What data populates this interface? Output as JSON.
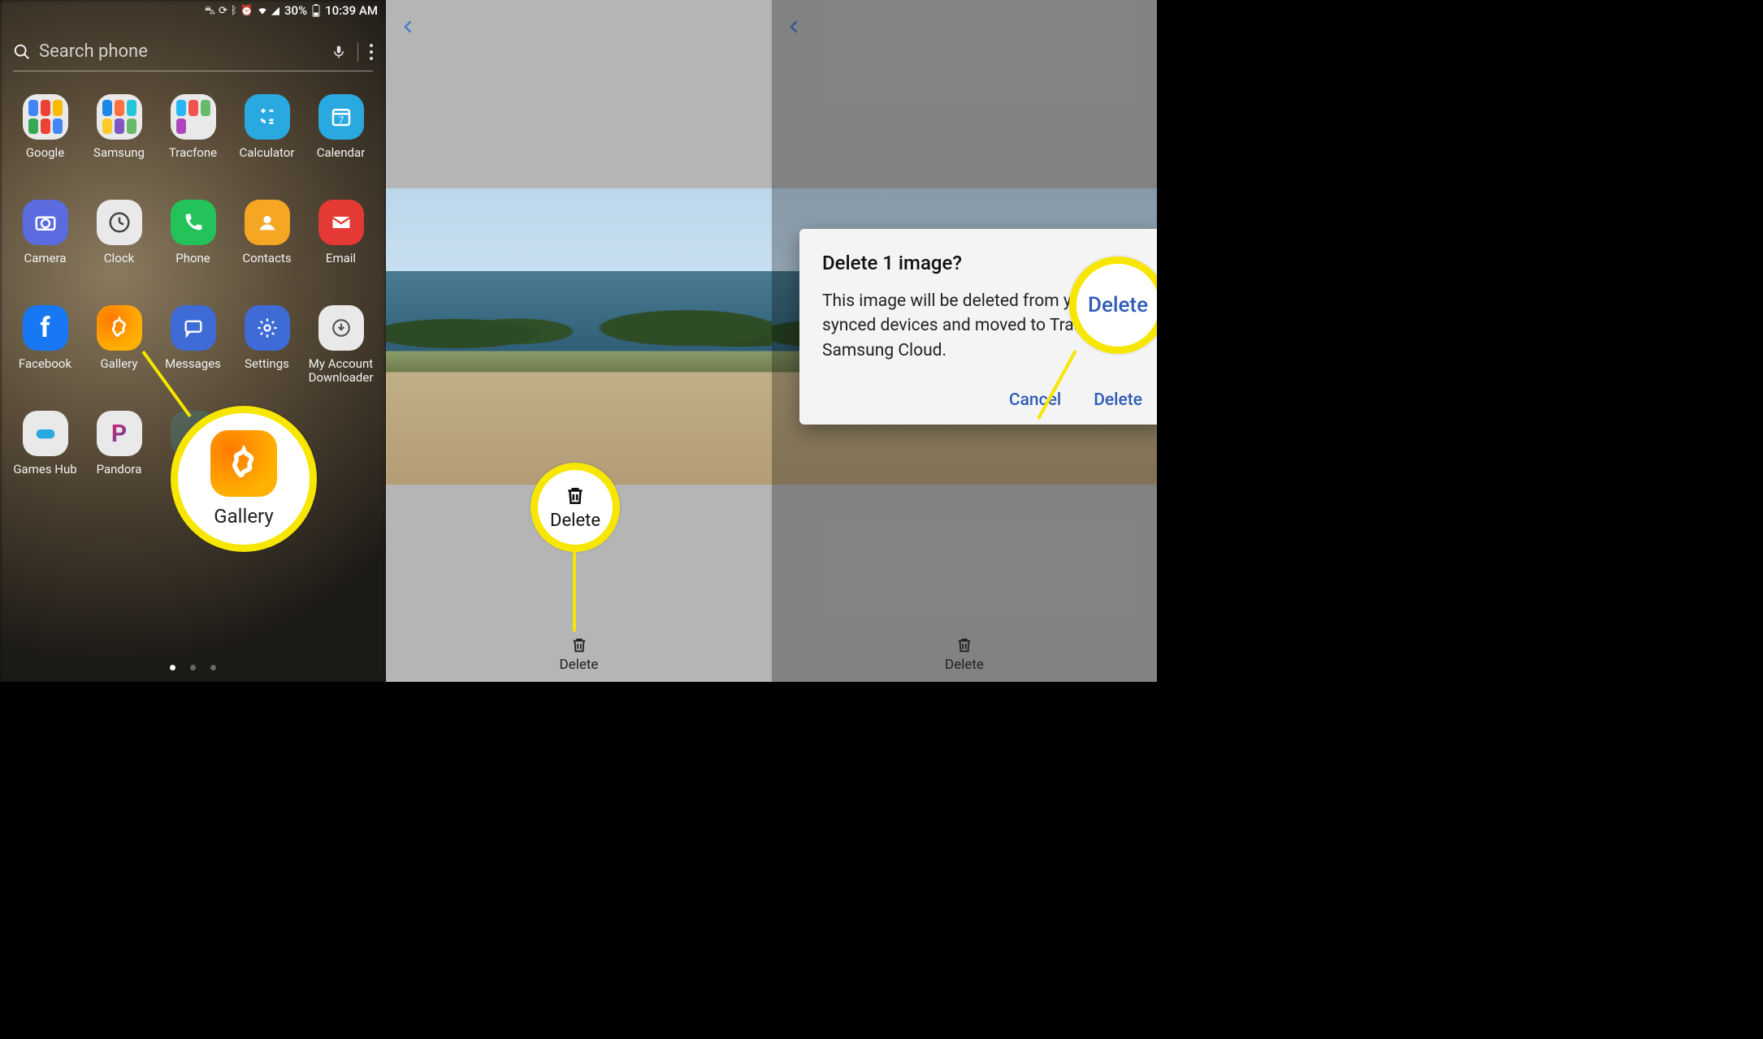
{
  "status": {
    "battery_pct": "30%",
    "time": "10:39 AM",
    "icons": [
      "car",
      "sync",
      "bluetooth",
      "alarm",
      "wifi",
      "signal",
      "battery"
    ]
  },
  "search": {
    "placeholder": "Search phone"
  },
  "apps": {
    "row1": [
      {
        "label": "Google"
      },
      {
        "label": "Samsung"
      },
      {
        "label": "Tracfone"
      },
      {
        "label": "Calculator"
      },
      {
        "label": "Calendar"
      }
    ],
    "row2": [
      {
        "label": "Camera"
      },
      {
        "label": "Clock"
      },
      {
        "label": "Phone"
      },
      {
        "label": "Contacts"
      },
      {
        "label": "Email"
      }
    ],
    "row3": [
      {
        "label": "Facebook"
      },
      {
        "label": "Gallery"
      },
      {
        "label": "Messages"
      },
      {
        "label": "Settings"
      },
      {
        "label": "My Account Downloader"
      }
    ],
    "row4": [
      {
        "label": "Games Hub"
      },
      {
        "label": "Pandora"
      }
    ]
  },
  "pager": {
    "count": 3,
    "active": 0
  },
  "callouts": {
    "gallery_label": "Gallery",
    "delete_label": "Delete",
    "delete_callout_big": "Delete"
  },
  "bottom_delete": "Delete",
  "dialog": {
    "title": "Delete 1 image?",
    "body": "This image will be deleted from your synced devices and moved to Trash in Samsung Cloud.",
    "cancel": "Cancel",
    "confirm": "Delete"
  },
  "colors": {
    "highlight": "#f7e600",
    "link": "#2f5bb7"
  }
}
